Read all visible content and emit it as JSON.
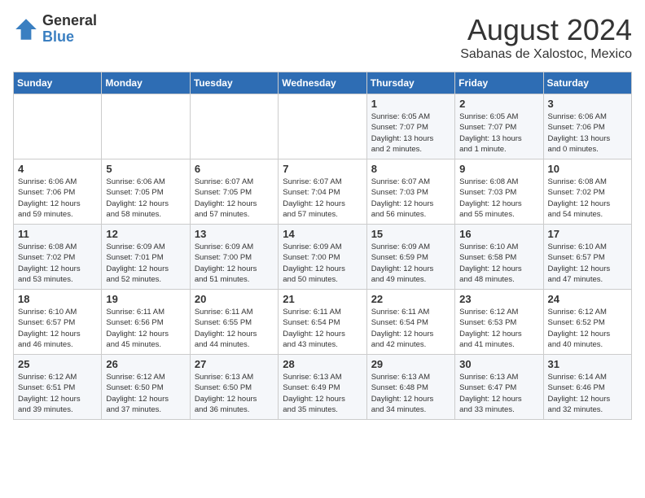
{
  "header": {
    "logo_general": "General",
    "logo_blue": "Blue",
    "month_year": "August 2024",
    "location": "Sabanas de Xalostoc, Mexico"
  },
  "days_of_week": [
    "Sunday",
    "Monday",
    "Tuesday",
    "Wednesday",
    "Thursday",
    "Friday",
    "Saturday"
  ],
  "weeks": [
    [
      {
        "day": "",
        "info": ""
      },
      {
        "day": "",
        "info": ""
      },
      {
        "day": "",
        "info": ""
      },
      {
        "day": "",
        "info": ""
      },
      {
        "day": "1",
        "info": "Sunrise: 6:05 AM\nSunset: 7:07 PM\nDaylight: 13 hours\nand 2 minutes."
      },
      {
        "day": "2",
        "info": "Sunrise: 6:05 AM\nSunset: 7:07 PM\nDaylight: 13 hours\nand 1 minute."
      },
      {
        "day": "3",
        "info": "Sunrise: 6:06 AM\nSunset: 7:06 PM\nDaylight: 13 hours\nand 0 minutes."
      }
    ],
    [
      {
        "day": "4",
        "info": "Sunrise: 6:06 AM\nSunset: 7:06 PM\nDaylight: 12 hours\nand 59 minutes."
      },
      {
        "day": "5",
        "info": "Sunrise: 6:06 AM\nSunset: 7:05 PM\nDaylight: 12 hours\nand 58 minutes."
      },
      {
        "day": "6",
        "info": "Sunrise: 6:07 AM\nSunset: 7:05 PM\nDaylight: 12 hours\nand 57 minutes."
      },
      {
        "day": "7",
        "info": "Sunrise: 6:07 AM\nSunset: 7:04 PM\nDaylight: 12 hours\nand 57 minutes."
      },
      {
        "day": "8",
        "info": "Sunrise: 6:07 AM\nSunset: 7:03 PM\nDaylight: 12 hours\nand 56 minutes."
      },
      {
        "day": "9",
        "info": "Sunrise: 6:08 AM\nSunset: 7:03 PM\nDaylight: 12 hours\nand 55 minutes."
      },
      {
        "day": "10",
        "info": "Sunrise: 6:08 AM\nSunset: 7:02 PM\nDaylight: 12 hours\nand 54 minutes."
      }
    ],
    [
      {
        "day": "11",
        "info": "Sunrise: 6:08 AM\nSunset: 7:02 PM\nDaylight: 12 hours\nand 53 minutes."
      },
      {
        "day": "12",
        "info": "Sunrise: 6:09 AM\nSunset: 7:01 PM\nDaylight: 12 hours\nand 52 minutes."
      },
      {
        "day": "13",
        "info": "Sunrise: 6:09 AM\nSunset: 7:00 PM\nDaylight: 12 hours\nand 51 minutes."
      },
      {
        "day": "14",
        "info": "Sunrise: 6:09 AM\nSunset: 7:00 PM\nDaylight: 12 hours\nand 50 minutes."
      },
      {
        "day": "15",
        "info": "Sunrise: 6:09 AM\nSunset: 6:59 PM\nDaylight: 12 hours\nand 49 minutes."
      },
      {
        "day": "16",
        "info": "Sunrise: 6:10 AM\nSunset: 6:58 PM\nDaylight: 12 hours\nand 48 minutes."
      },
      {
        "day": "17",
        "info": "Sunrise: 6:10 AM\nSunset: 6:57 PM\nDaylight: 12 hours\nand 47 minutes."
      }
    ],
    [
      {
        "day": "18",
        "info": "Sunrise: 6:10 AM\nSunset: 6:57 PM\nDaylight: 12 hours\nand 46 minutes."
      },
      {
        "day": "19",
        "info": "Sunrise: 6:11 AM\nSunset: 6:56 PM\nDaylight: 12 hours\nand 45 minutes."
      },
      {
        "day": "20",
        "info": "Sunrise: 6:11 AM\nSunset: 6:55 PM\nDaylight: 12 hours\nand 44 minutes."
      },
      {
        "day": "21",
        "info": "Sunrise: 6:11 AM\nSunset: 6:54 PM\nDaylight: 12 hours\nand 43 minutes."
      },
      {
        "day": "22",
        "info": "Sunrise: 6:11 AM\nSunset: 6:54 PM\nDaylight: 12 hours\nand 42 minutes."
      },
      {
        "day": "23",
        "info": "Sunrise: 6:12 AM\nSunset: 6:53 PM\nDaylight: 12 hours\nand 41 minutes."
      },
      {
        "day": "24",
        "info": "Sunrise: 6:12 AM\nSunset: 6:52 PM\nDaylight: 12 hours\nand 40 minutes."
      }
    ],
    [
      {
        "day": "25",
        "info": "Sunrise: 6:12 AM\nSunset: 6:51 PM\nDaylight: 12 hours\nand 39 minutes."
      },
      {
        "day": "26",
        "info": "Sunrise: 6:12 AM\nSunset: 6:50 PM\nDaylight: 12 hours\nand 37 minutes."
      },
      {
        "day": "27",
        "info": "Sunrise: 6:13 AM\nSunset: 6:50 PM\nDaylight: 12 hours\nand 36 minutes."
      },
      {
        "day": "28",
        "info": "Sunrise: 6:13 AM\nSunset: 6:49 PM\nDaylight: 12 hours\nand 35 minutes."
      },
      {
        "day": "29",
        "info": "Sunrise: 6:13 AM\nSunset: 6:48 PM\nDaylight: 12 hours\nand 34 minutes."
      },
      {
        "day": "30",
        "info": "Sunrise: 6:13 AM\nSunset: 6:47 PM\nDaylight: 12 hours\nand 33 minutes."
      },
      {
        "day": "31",
        "info": "Sunrise: 6:14 AM\nSunset: 6:46 PM\nDaylight: 12 hours\nand 32 minutes."
      }
    ]
  ]
}
